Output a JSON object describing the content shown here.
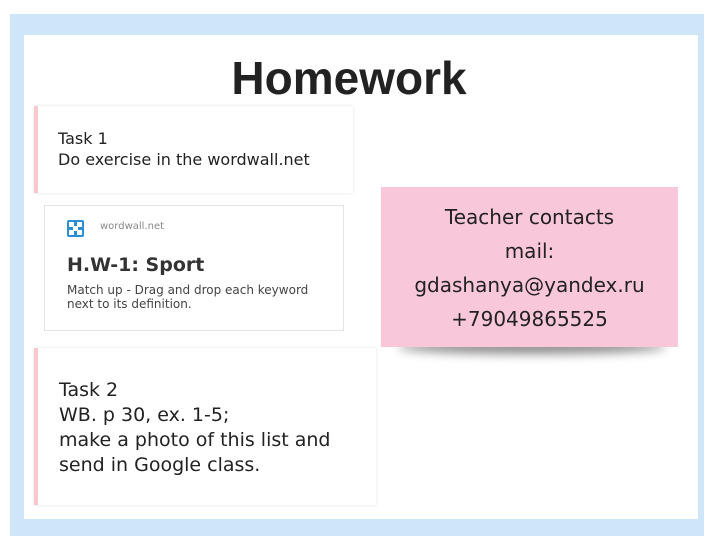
{
  "slide": {
    "title": "Homework"
  },
  "task1": {
    "label": "Task 1",
    "text": "Do exercise in the  wordwall.net"
  },
  "link_preview": {
    "site": "wordwall.net",
    "title": "H.W-1: Sport",
    "description": "Match up - Drag and drop each keyword next to its definition."
  },
  "task2": {
    "label": "Task 2",
    "lines": [
      "WB. p 30, ex. 1-5;",
      "make a photo of this list and",
      "send in Google class."
    ]
  },
  "contacts": {
    "heading": "Teacher contacts",
    "mail_label": "mail:",
    "email": "gdashanya@yandex.ru",
    "phone": "+79049865525"
  },
  "colors": {
    "frame_background": "#cfe6f9",
    "sticky_note": "#f9c7da",
    "card_accent": "#f6c9cf",
    "wordwall_logo": "#2a8fd4"
  }
}
